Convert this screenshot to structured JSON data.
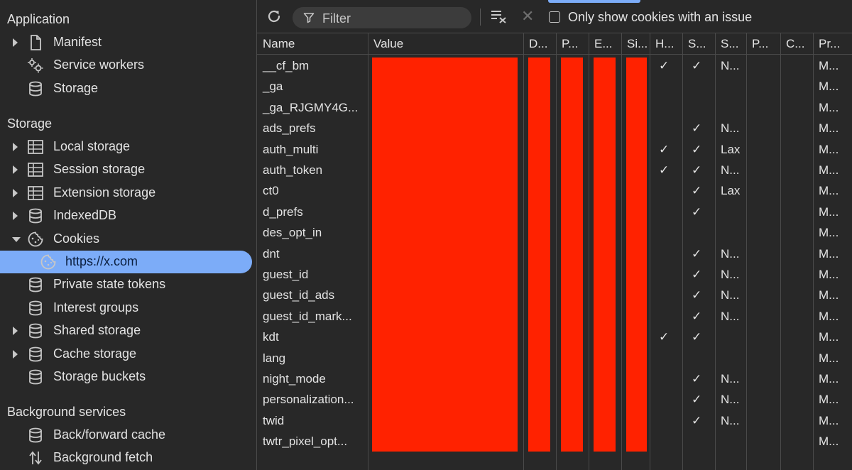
{
  "sidebar": {
    "application_title": "Application",
    "storage_title": "Storage",
    "background_title": "Background services",
    "app_items": [
      {
        "label": "Manifest",
        "icon": "document-icon",
        "arrow": "right"
      },
      {
        "label": "Service workers",
        "icon": "gears-icon",
        "arrow": ""
      },
      {
        "label": "Storage",
        "icon": "database-icon",
        "arrow": ""
      }
    ],
    "storage_items": [
      {
        "label": "Local storage",
        "icon": "table-icon",
        "arrow": "right"
      },
      {
        "label": "Session storage",
        "icon": "table-icon",
        "arrow": "right"
      },
      {
        "label": "Extension storage",
        "icon": "table-icon",
        "arrow": "right"
      },
      {
        "label": "IndexedDB",
        "icon": "database-icon",
        "arrow": "right"
      },
      {
        "label": "Cookies",
        "icon": "cookie-icon",
        "arrow": "down"
      },
      {
        "label": "https://x.com",
        "icon": "cookie-icon",
        "arrow": "",
        "sub": true,
        "selected": true
      },
      {
        "label": "Private state tokens",
        "icon": "database-icon",
        "arrow": ""
      },
      {
        "label": "Interest groups",
        "icon": "database-icon",
        "arrow": ""
      },
      {
        "label": "Shared storage",
        "icon": "database-icon",
        "arrow": "right"
      },
      {
        "label": "Cache storage",
        "icon": "database-icon",
        "arrow": "right"
      },
      {
        "label": "Storage buckets",
        "icon": "database-icon",
        "arrow": ""
      }
    ],
    "background_items": [
      {
        "label": "Back/forward cache",
        "icon": "database-icon",
        "arrow": ""
      },
      {
        "label": "Background fetch",
        "icon": "arrows-updown-icon",
        "arrow": ""
      }
    ]
  },
  "toolbar": {
    "filter_placeholder": "Filter",
    "issue_only_label": "Only show cookies with an issue",
    "issue_only_checked": false
  },
  "table": {
    "columns": [
      "Name",
      "Value",
      "D...",
      "P...",
      "E...",
      "Si...",
      "H...",
      "S...",
      "S...",
      "P...",
      "C...",
      "Pr..."
    ],
    "rows": [
      {
        "name": "__cf_bm",
        "http": "✓",
        "secure": "✓",
        "samesite": "N...",
        "priority": "M..."
      },
      {
        "name": "_ga",
        "http": "",
        "secure": "",
        "samesite": "",
        "priority": "M..."
      },
      {
        "name": "_ga_RJGMY4G...",
        "http": "",
        "secure": "",
        "samesite": "",
        "priority": "M..."
      },
      {
        "name": "ads_prefs",
        "http": "",
        "secure": "✓",
        "samesite": "N...",
        "priority": "M..."
      },
      {
        "name": "auth_multi",
        "http": "✓",
        "secure": "✓",
        "samesite": "Lax",
        "priority": "M..."
      },
      {
        "name": "auth_token",
        "http": "✓",
        "secure": "✓",
        "samesite": "N...",
        "priority": "M..."
      },
      {
        "name": "ct0",
        "http": "",
        "secure": "✓",
        "samesite": "Lax",
        "priority": "M..."
      },
      {
        "name": "d_prefs",
        "http": "",
        "secure": "✓",
        "samesite": "",
        "priority": "M..."
      },
      {
        "name": "des_opt_in",
        "http": "",
        "secure": "",
        "samesite": "",
        "priority": "M..."
      },
      {
        "name": "dnt",
        "http": "",
        "secure": "✓",
        "samesite": "N...",
        "priority": "M..."
      },
      {
        "name": "guest_id",
        "http": "",
        "secure": "✓",
        "samesite": "N...",
        "priority": "M..."
      },
      {
        "name": "guest_id_ads",
        "http": "",
        "secure": "✓",
        "samesite": "N...",
        "priority": "M..."
      },
      {
        "name": "guest_id_mark...",
        "http": "",
        "secure": "✓",
        "samesite": "N...",
        "priority": "M..."
      },
      {
        "name": "kdt",
        "http": "✓",
        "secure": "✓",
        "samesite": "",
        "priority": "M..."
      },
      {
        "name": "lang",
        "http": "",
        "secure": "",
        "samesite": "",
        "priority": "M..."
      },
      {
        "name": "night_mode",
        "http": "",
        "secure": "✓",
        "samesite": "N...",
        "priority": "M..."
      },
      {
        "name": "personalization...",
        "http": "",
        "secure": "✓",
        "samesite": "N...",
        "priority": "M..."
      },
      {
        "name": "twid",
        "http": "",
        "secure": "✓",
        "samesite": "N...",
        "priority": "M..."
      },
      {
        "name": "twtr_pixel_opt...",
        "http": "",
        "secure": "",
        "samesite": "",
        "priority": "M..."
      }
    ]
  },
  "colors": {
    "background": "#282828",
    "selection": "#7cacf8",
    "redaction": "#ff2200"
  }
}
